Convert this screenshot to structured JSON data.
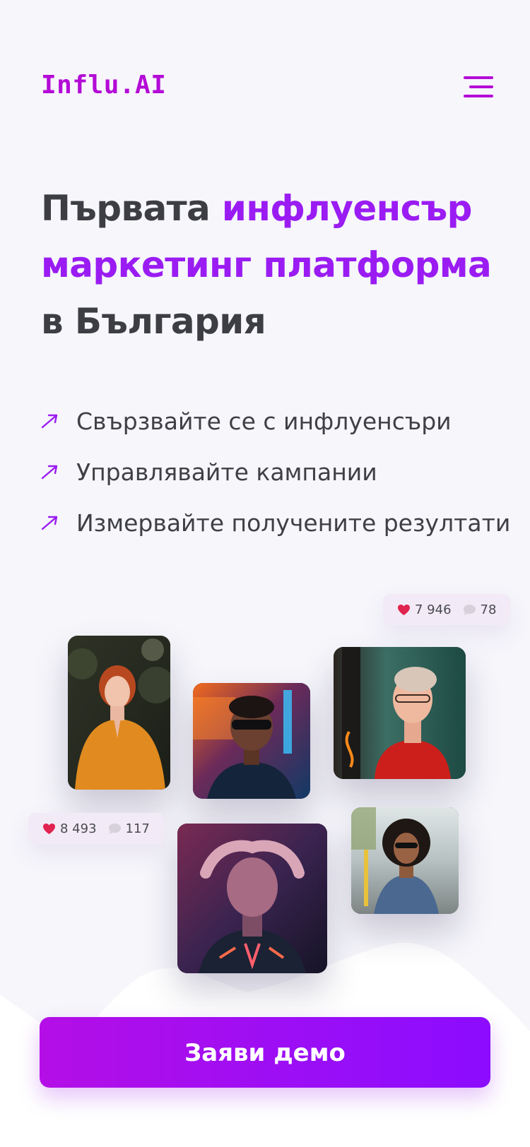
{
  "header": {
    "logo": "Influ.AI",
    "menu_icon": "hamburger-menu-icon"
  },
  "hero": {
    "title_part1": "Първата ",
    "title_accent": "инфлуенсър маркетинг платформа",
    "title_part2": " в България"
  },
  "features": [
    {
      "icon": "arrow-up-right-icon",
      "label": "Свързвайте се с инфлуенсъри"
    },
    {
      "icon": "arrow-up-right-icon",
      "label": "Управлявайте кампании"
    },
    {
      "icon": "arrow-up-right-icon",
      "label": "Измервайте получените резултати"
    }
  ],
  "stats": [
    {
      "likes": "7 946",
      "comments": "78"
    },
    {
      "likes": "8 493",
      "comments": "117"
    }
  ],
  "cta": {
    "label": "Заяви демо"
  },
  "colors": {
    "accent": "#9a1cf2",
    "logo": "#b40ad6",
    "background": "#f6f6fb",
    "text": "#3d3d44",
    "heart": "#e0244f",
    "button_start": "#b40ee6",
    "button_end": "#8c0cff"
  }
}
